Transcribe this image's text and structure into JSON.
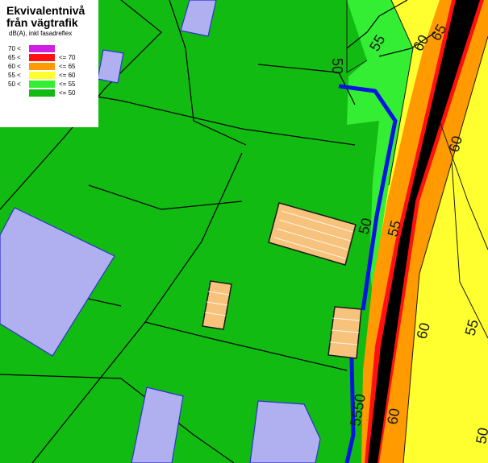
{
  "legend": {
    "title_line1": "Ekvivalentnivå",
    "title_line2": "från vägtrafik",
    "subtitle": "dB(A), inkl fasadreflex",
    "classes": [
      {
        "low": "70 <",
        "high": "",
        "color": "#d020e0"
      },
      {
        "low": "65 <",
        "high": "<= 70",
        "color": "#ff1010"
      },
      {
        "low": "60 <",
        "high": "<= 65",
        "color": "#ff9a00"
      },
      {
        "low": "55 <",
        "high": "<= 60",
        "color": "#ffff30"
      },
      {
        "low": "50 <",
        "high": "<= 55",
        "color": "#33ee33"
      },
      {
        "low": "",
        "high": "<= 50",
        "color": "#11bb11"
      }
    ]
  },
  "contour_labels": {
    "l50_top": "50",
    "l55_top": "55",
    "l60_top": "60",
    "l65_top": "65",
    "l60_right": "60",
    "l50_mid": "50",
    "l55_mid": "55",
    "l60_low": "60",
    "l55_right": "55",
    "l5550_bottom": "5550",
    "l60_bottom": "60",
    "l50_right": "50"
  },
  "colors": {
    "quiet": "#11bb11",
    "zone50": "#33ee33",
    "zone55": "#ffff30",
    "zone60": "#ff9a00",
    "zone65": "#ff1010",
    "road": "#000000",
    "building_outside": "#b0b0f0",
    "building_assessed": "#f7c27c",
    "noise_barrier": "#0a14e0"
  }
}
